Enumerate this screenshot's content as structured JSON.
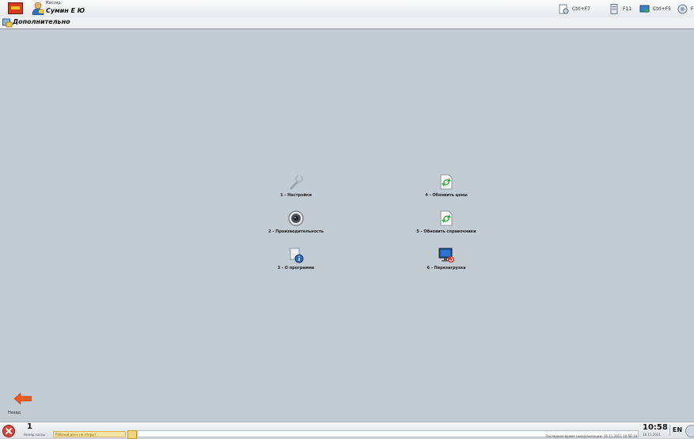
{
  "header": {
    "cashier_label": "Кассир:",
    "cashier_name": "Сумин Е Ю",
    "hotkeys": [
      {
        "label": "Ctrl+F7",
        "icon": "report-icon"
      },
      {
        "label": "F11",
        "icon": "document-icon"
      },
      {
        "label": "Ctrl+F5",
        "icon": "transfer-icon"
      },
      {
        "label": "F",
        "icon": "support-icon"
      }
    ]
  },
  "section": {
    "title": "Дополнительно"
  },
  "menu": {
    "items": [
      {
        "label": "1 - Настройки",
        "icon": "wrench-icon"
      },
      {
        "label": "2 - Производительность",
        "icon": "speaker-icon"
      },
      {
        "label": "3 - О программе",
        "icon": "info-icon"
      },
      {
        "label": "4 - Обновить цены",
        "icon": "refresh-icon"
      },
      {
        "label": "5 - Обновить справочники",
        "icon": "refresh-icon"
      },
      {
        "label": "6 - Перезагрузка",
        "icon": "monitor-restart-icon"
      }
    ]
  },
  "back": {
    "label": "Назад"
  },
  "status": {
    "register_number": "1",
    "register_label": "Номер кассы",
    "day_status": "Рабочий день не открыт",
    "sync_text": "Последнее время синхронизации: 16.11.2021 10:58:18",
    "time": "10:58",
    "date": "16.11.2021",
    "language": "EN"
  },
  "colors": {
    "background": "#c3cbd3",
    "refresh_green": "#36a63a",
    "back_arrow": "#f05a1e"
  }
}
